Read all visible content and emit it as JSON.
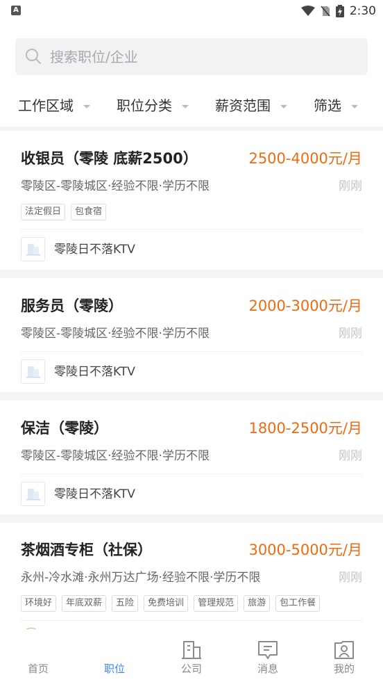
{
  "status_bar": {
    "time": "2:30",
    "app_badge": "A"
  },
  "search": {
    "placeholder": "搜索职位/企业"
  },
  "filters": [
    {
      "label": "工作区域"
    },
    {
      "label": "职位分类"
    },
    {
      "label": "薪资范围"
    },
    {
      "label": "筛选"
    }
  ],
  "jobs": [
    {
      "title": "收银员（零陵 底薪2500）",
      "salary": "2500-4000元/月",
      "meta": "零陵区-零陵城区·经验不限·学历不限",
      "time": "刚刚",
      "tags": [
        "法定假日",
        "包食宿"
      ],
      "company": "零陵日不落KTV"
    },
    {
      "title": "服务员（零陵）",
      "salary": "2000-3000元/月",
      "meta": "零陵区-零陵城区·经验不限·学历不限",
      "time": "刚刚",
      "tags": [],
      "company": "零陵日不落KTV"
    },
    {
      "title": "保洁（零陵）",
      "salary": "1800-2500元/月",
      "meta": "零陵区-零陵城区·经验不限·学历不限",
      "time": "刚刚",
      "tags": [],
      "company": "零陵日不落KTV"
    },
    {
      "title": "茶烟酒专柜（社保）",
      "salary": "3000-5000元/月",
      "meta": "永州-冷水滩·永州万达广场·经验不限·学历不限",
      "time": "刚刚",
      "tags": [
        "环境好",
        "年底双薪",
        "五险",
        "免费培训",
        "管理规范",
        "旅游",
        "包工作餐"
      ]
    }
  ],
  "tabs": [
    {
      "label": "首页",
      "active": false,
      "icon": "home-icon"
    },
    {
      "label": "职位",
      "active": true,
      "icon": "briefcase-icon"
    },
    {
      "label": "公司",
      "active": false,
      "icon": "building-icon"
    },
    {
      "label": "消息",
      "active": false,
      "icon": "message-icon"
    },
    {
      "label": "我的",
      "active": false,
      "icon": "profile-icon"
    }
  ],
  "colors": {
    "accent": "#3a86ff",
    "salary": "#f06a0f"
  }
}
